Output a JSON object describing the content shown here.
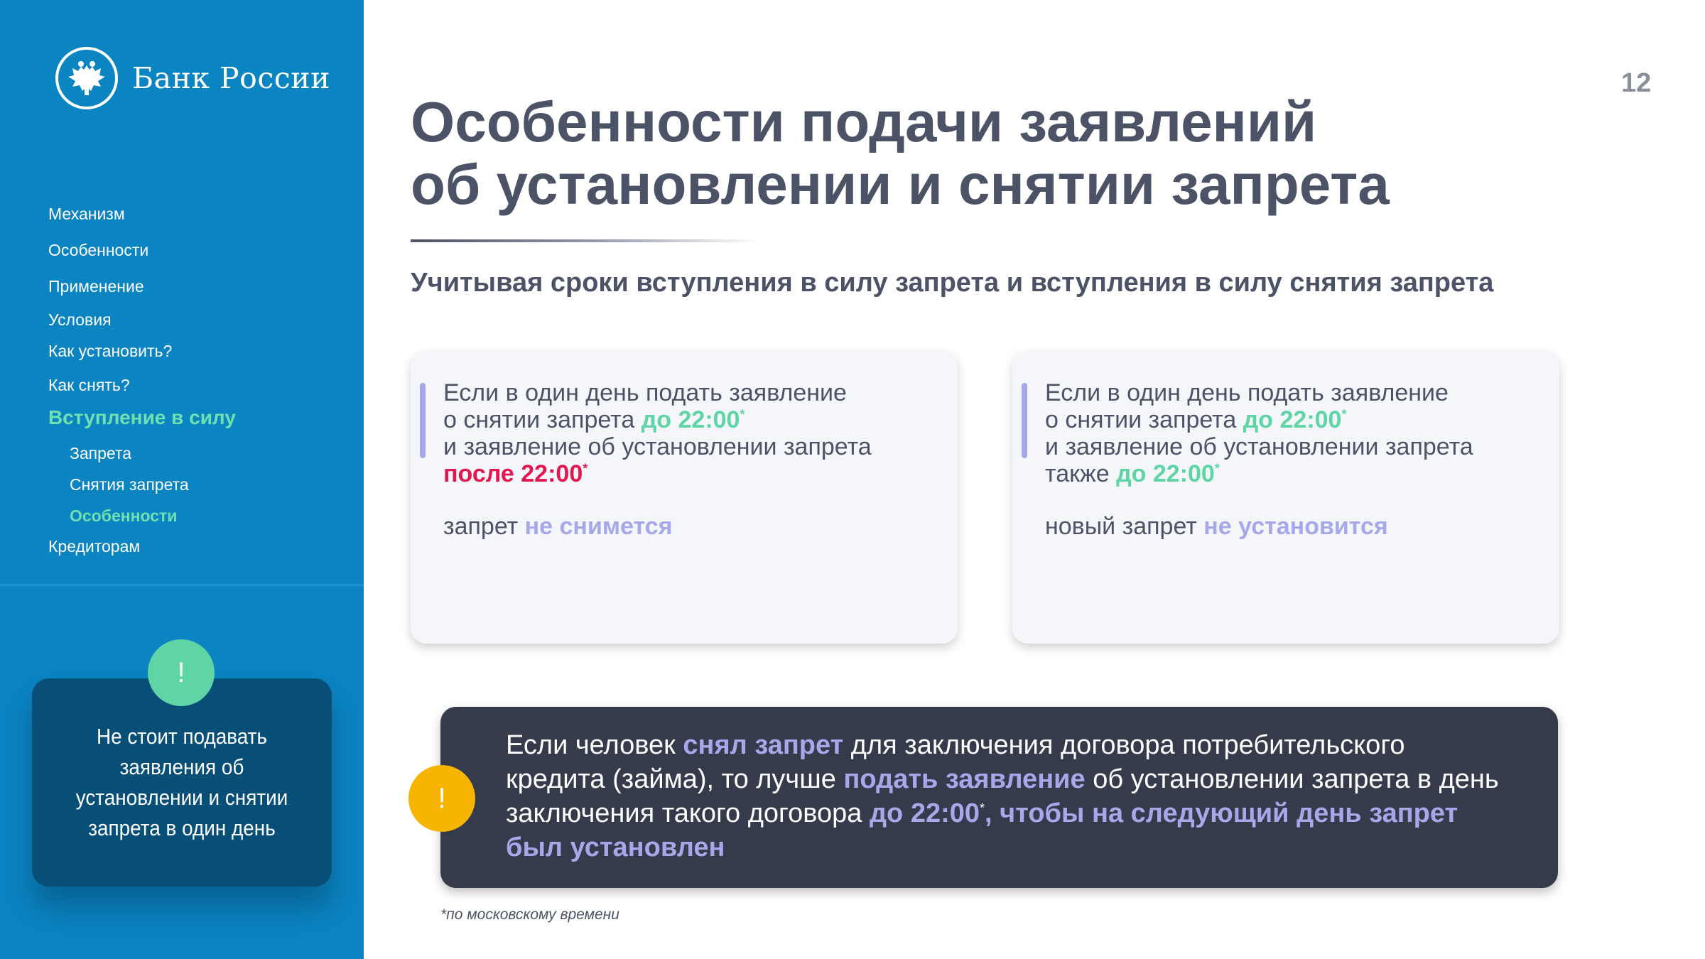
{
  "logo": {
    "text": "Банк России",
    "icon": "double-headed-eagle-icon"
  },
  "page_number": "12",
  "nav": [
    {
      "label": "Механизм"
    },
    {
      "label": "Особенности"
    },
    {
      "label": "Применение"
    },
    {
      "label": "Условия"
    },
    {
      "label": "Как установить?"
    },
    {
      "label": "Как снять?"
    },
    {
      "label": "Вступление в силу",
      "active": true
    },
    {
      "label": "Запрета",
      "sub": true
    },
    {
      "label": "Снятия запрета",
      "sub": true
    },
    {
      "label": "Особенности",
      "sub": true,
      "active": true
    },
    {
      "label": "Кредиторам"
    }
  ],
  "sidebar_warning": {
    "badge": "!",
    "text": "Не стоит подавать заявления об установлении и снятии запрета в один день"
  },
  "title_line1": "Особенности подачи заявлений",
  "title_line2": "об установлении и снятии запрета",
  "subtitle": "Учитывая сроки вступления в силу запрета и вступления в силу снятия запрета",
  "card_left": {
    "line1": "Если в один день подать заявление",
    "line2_pre": "о снятии запрета ",
    "line2_hl": "до 22:00",
    "star": "*",
    "line3": "и заявление об установлении запрета",
    "line4_hl": "после 22:00",
    "result_pre": "запрет ",
    "result_hl": "не снимется"
  },
  "card_right": {
    "line1": "Если в один день подать заявление",
    "line2_pre": "о снятии запрета ",
    "line2_hl": "до 22:00",
    "star": "*",
    "line3": "и заявление об установлении запрета",
    "line4_pre": "также ",
    "line4_hl": "до 22:00",
    "result_pre": "новый запрет ",
    "result_hl": "не установится"
  },
  "notice": {
    "badge": "!",
    "p1": "Если человек ",
    "h1": "снял запрет",
    "p2": " для заключения договора потребительского кредита (займа), то лучше ",
    "h2": "подать заявление",
    "p3": " об установлении запрета в день заключения такого договора ",
    "h3": "до 22:00",
    "star": "*",
    "h4": ", чтобы на следующий день запрет был установлен"
  },
  "footnote": "*по московскому времени",
  "colors": {
    "sidebar": "#0b84c2",
    "accent_green": "#5fd4a4",
    "accent_red": "#e1174f",
    "accent_lavender": "#a6a8ea",
    "title": "#4d5366",
    "dark_panel": "#363b4c",
    "badge_yellow": "#f7b500"
  }
}
